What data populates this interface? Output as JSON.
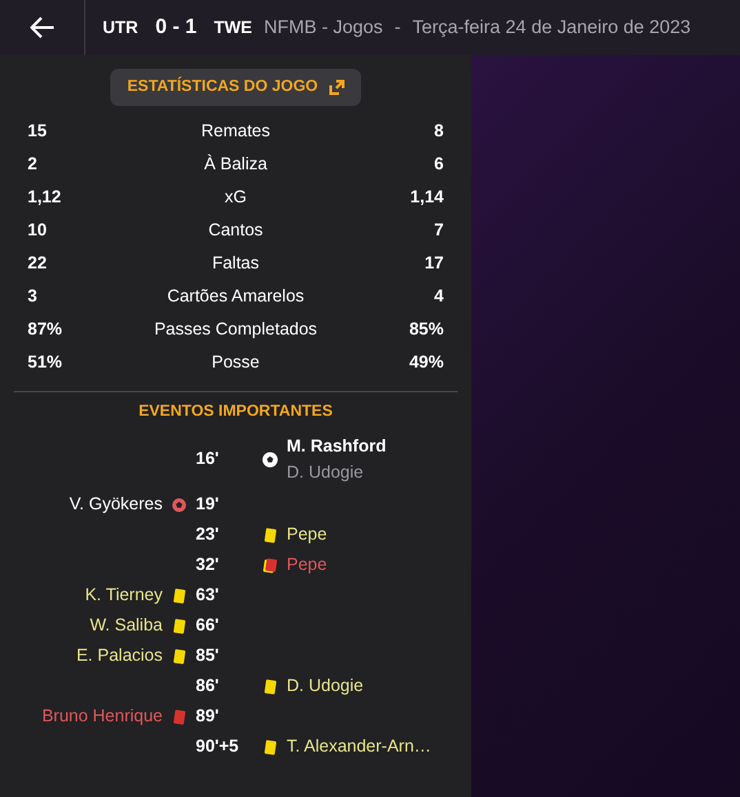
{
  "header": {
    "home": "UTR",
    "score": "0 - 1",
    "away": "TWE",
    "competition": "NFMB - Jogos",
    "separator": "-",
    "date": "Terça-feira 24 de Janeiro de 2023"
  },
  "stats_button": "ESTATÍSTICAS DO JOGO",
  "stats": [
    {
      "home": "15",
      "label": "Remates",
      "away": "8"
    },
    {
      "home": "2",
      "label": "À Baliza",
      "away": "6"
    },
    {
      "home": "1,12",
      "label": "xG",
      "away": "1,14"
    },
    {
      "home": "10",
      "label": "Cantos",
      "away": "7"
    },
    {
      "home": "22",
      "label": "Faltas",
      "away": "17"
    },
    {
      "home": "3",
      "label": "Cartões Amarelos",
      "away": "4"
    },
    {
      "home": "87%",
      "label": "Passes Completados",
      "away": "85%"
    },
    {
      "home": "51%",
      "label": "Posse",
      "away": "49%"
    }
  ],
  "events_title": "EVENTOS IMPORTANTES",
  "events": [
    {
      "home": false,
      "kind": "goal",
      "minute": "16'",
      "player": "M. Rashford",
      "assist": "D. Udogie"
    },
    {
      "home": true,
      "kind": "miss",
      "minute": "19'",
      "player": "V. Gyökeres"
    },
    {
      "home": false,
      "kind": "yellow",
      "minute": "23'",
      "player": "Pepe"
    },
    {
      "home": false,
      "kind": "second_yellow",
      "minute": "32'",
      "player": "Pepe"
    },
    {
      "home": true,
      "kind": "yellow",
      "minute": "63'",
      "player": "K. Tierney"
    },
    {
      "home": true,
      "kind": "yellow",
      "minute": "66'",
      "player": "W. Saliba"
    },
    {
      "home": true,
      "kind": "yellow",
      "minute": "85'",
      "player": "E. Palacios"
    },
    {
      "home": false,
      "kind": "yellow",
      "minute": "86'",
      "player": "D. Udogie"
    },
    {
      "home": true,
      "kind": "red",
      "minute": "89'",
      "player": "Bruno Henrique"
    },
    {
      "home": false,
      "kind": "yellow",
      "minute": "90'+5",
      "player": "T. Alexander-Arn…"
    }
  ]
}
